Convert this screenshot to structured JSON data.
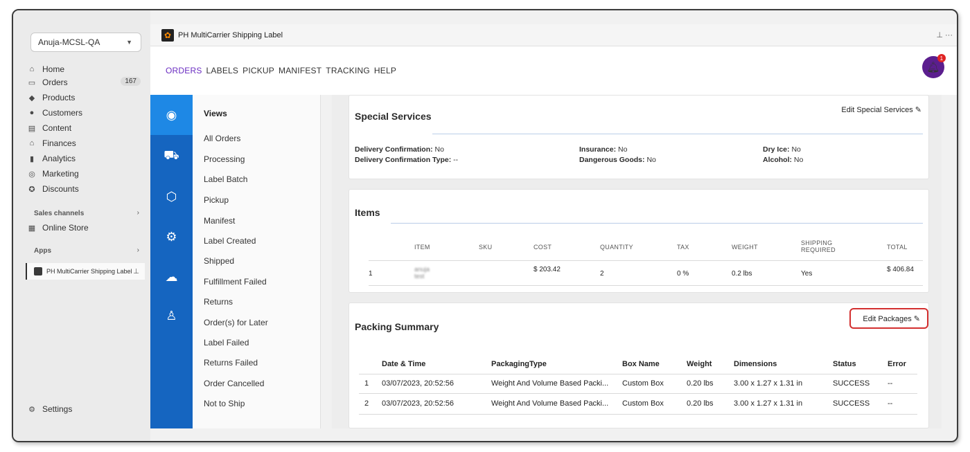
{
  "store": {
    "name": "Anuja-MCSL-QA"
  },
  "nav": {
    "items": [
      {
        "label": "Home",
        "icon": "home-icon"
      },
      {
        "label": "Orders",
        "icon": "orders-icon",
        "badge": "167"
      },
      {
        "label": "Products",
        "icon": "products-icon"
      },
      {
        "label": "Customers",
        "icon": "customers-icon"
      },
      {
        "label": "Content",
        "icon": "content-icon"
      },
      {
        "label": "Finances",
        "icon": "finances-icon"
      },
      {
        "label": "Analytics",
        "icon": "analytics-icon"
      },
      {
        "label": "Marketing",
        "icon": "marketing-icon"
      },
      {
        "label": "Discounts",
        "icon": "discounts-icon"
      }
    ],
    "sales_channels": "Sales channels",
    "online_store": "Online Store",
    "apps": "Apps",
    "app_item": "PH MultiCarrier Shipping Label",
    "settings": "Settings"
  },
  "appbar": {
    "title": "PH MultiCarrier Shipping Label",
    "more": "···"
  },
  "topmenu": {
    "items": [
      "ORDERS",
      "LABELS",
      "PICKUP",
      "MANIFEST",
      "TRACKING",
      "HELP"
    ],
    "active": "ORDERS",
    "notifications": "1"
  },
  "views": {
    "header": "Views",
    "items": [
      "All Orders",
      "Processing",
      "Label Batch",
      "Pickup",
      "Manifest",
      "Label Created",
      "Shipped",
      "Fulfillment Failed",
      "Returns",
      "Order(s) for Later",
      "Label Failed",
      "Returns Failed",
      "Order Cancelled",
      "Not to Ship"
    ]
  },
  "special_services": {
    "title": "Special Services",
    "edit": "Edit Special Services",
    "fields": {
      "delivery_confirmation": {
        "label": "Delivery Confirmation:",
        "value": "No"
      },
      "delivery_confirmation_type": {
        "label": "Delivery Confirmation Type:",
        "value": "--"
      },
      "insurance": {
        "label": "Insurance:",
        "value": "No"
      },
      "dangerous_goods": {
        "label": "Dangerous Goods:",
        "value": "No"
      },
      "dry_ice": {
        "label": "Dry Ice:",
        "value": "No"
      },
      "alcohol": {
        "label": "Alcohol:",
        "value": "No"
      }
    }
  },
  "items": {
    "title": "Items",
    "columns": [
      "ITEM",
      "SKU",
      "COST",
      "QUANTITY",
      "TAX",
      "WEIGHT",
      "SHIPPING REQUIRED",
      "TOTAL"
    ],
    "rows": [
      {
        "index": "1",
        "item": "anuja test",
        "sku": "",
        "cost": "$ 203.42",
        "quantity": "2",
        "tax": "0 %",
        "weight": "0.2 lbs",
        "shipping_required": "Yes",
        "total": "$ 406.84"
      }
    ]
  },
  "packing": {
    "title": "Packing Summary",
    "edit": "Edit Packages",
    "columns": [
      "Date & Time",
      "PackagingType",
      "Box Name",
      "Weight",
      "Dimensions",
      "Status",
      "Error"
    ],
    "rows": [
      {
        "index": "1",
        "date": "03/07/2023, 20:52:56",
        "type": "Weight And Volume Based Packi...",
        "box": "Custom Box",
        "weight": "0.20 lbs",
        "dims": "3.00 x 1.27 x 1.31 in",
        "status": "SUCCESS",
        "error": "--"
      },
      {
        "index": "2",
        "date": "03/07/2023, 20:52:56",
        "type": "Weight And Volume Based Packi...",
        "box": "Custom Box",
        "weight": "0.20 lbs",
        "dims": "3.00 x 1.27 x 1.31 in",
        "status": "SUCCESS",
        "error": "--"
      }
    ]
  }
}
